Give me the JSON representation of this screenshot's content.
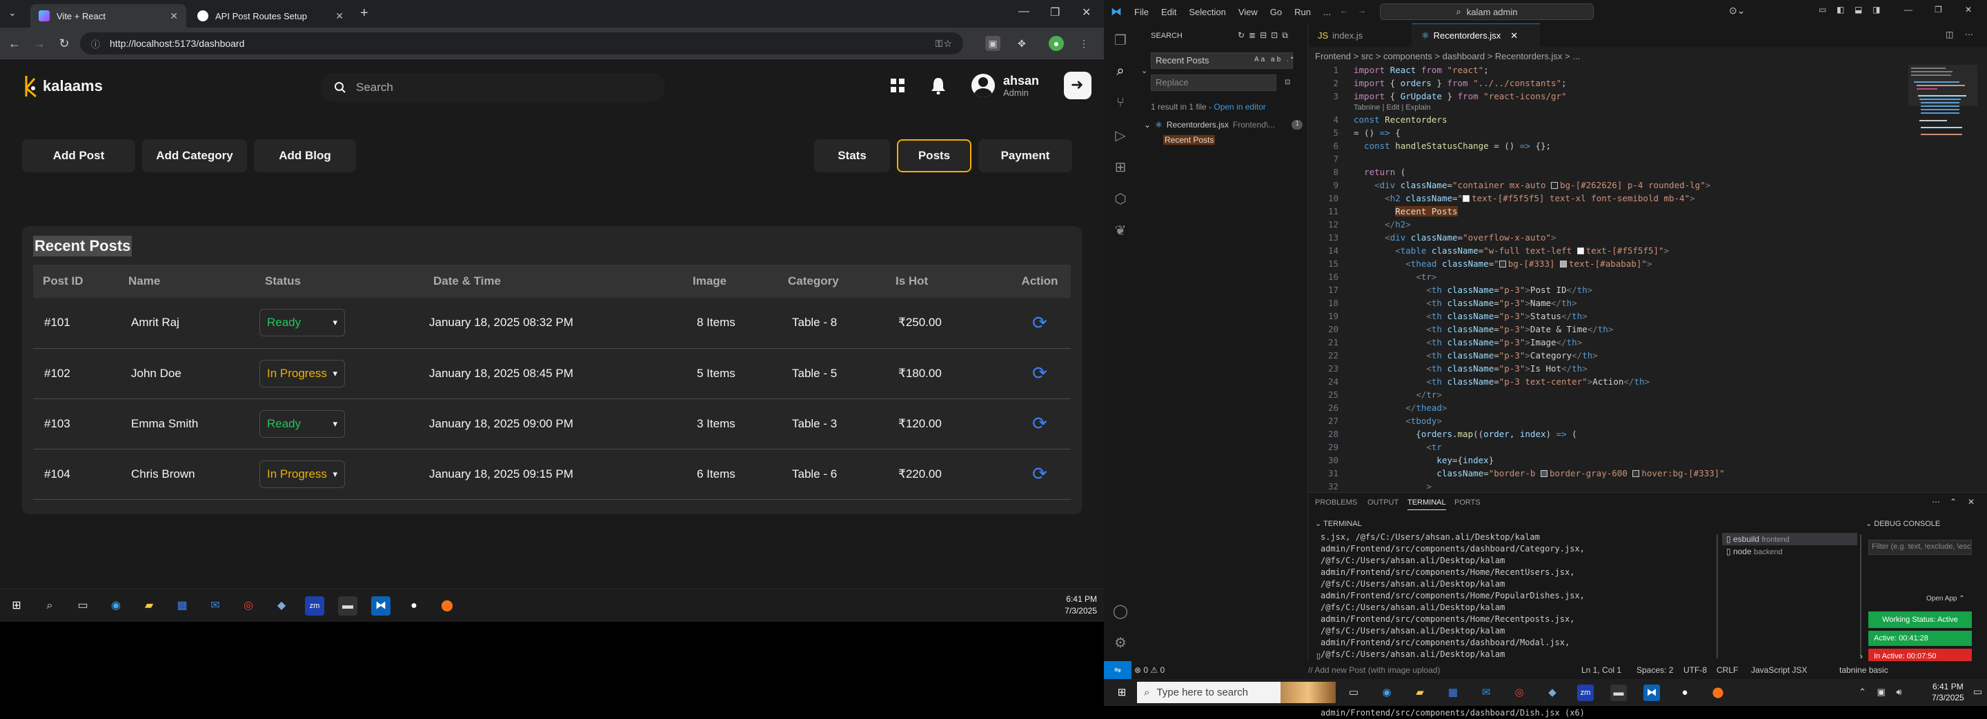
{
  "browser": {
    "tabs": [
      {
        "title": "Vite + React",
        "active": true
      },
      {
        "title": "API Post Routes Setup",
        "active": false
      }
    ],
    "url": "http://localhost:5173/dashboard"
  },
  "app": {
    "logo_text": "kalaams",
    "search_placeholder": "Search",
    "user": {
      "name": "ahsan",
      "role": "Admin"
    },
    "actions": [
      "Add Post",
      "Add Category",
      "Add Blog"
    ],
    "views": [
      {
        "label": "Stats",
        "active": false
      },
      {
        "label": "Posts",
        "active": true
      },
      {
        "label": "Payment",
        "active": false
      }
    ],
    "panel_title": "Recent Posts",
    "columns": [
      "Post ID",
      "Name",
      "Status",
      "Date & Time",
      "Image",
      "Category",
      "Is Hot",
      "Action"
    ],
    "rows": [
      {
        "id": "#101",
        "name": "Amrit Raj",
        "status": "Ready",
        "date": "January 18, 2025 08:32 PM",
        "image": "8 Items",
        "category": "Table - 8",
        "hot": "₹250.00"
      },
      {
        "id": "#102",
        "name": "John Doe",
        "status": "In Progress",
        "date": "January 18, 2025 08:45 PM",
        "image": "5 Items",
        "category": "Table - 5",
        "hot": "₹180.00"
      },
      {
        "id": "#103",
        "name": "Emma Smith",
        "status": "Ready",
        "date": "January 18, 2025 09:00 PM",
        "image": "3 Items",
        "category": "Table - 3",
        "hot": "₹120.00"
      },
      {
        "id": "#104",
        "name": "Chris Brown",
        "status": "In Progress",
        "date": "January 18, 2025 09:15 PM",
        "image": "6 Items",
        "category": "Table - 6",
        "hot": "₹220.00"
      }
    ],
    "colors": {
      "bg": "#1a1a1a",
      "panel": "#262626",
      "accent": "#f6b100",
      "ready": "#22c55e",
      "progress": "#eab308",
      "action": "#3b82f6"
    }
  },
  "left_taskbar": {
    "time": "6:41 PM",
    "date": "7/3/2025"
  },
  "vscode": {
    "menus": [
      "File",
      "Edit",
      "Selection",
      "View",
      "Go",
      "Run",
      "..."
    ],
    "command_center": "kalam admin",
    "search": {
      "header": "SEARCH",
      "query": "Recent Posts",
      "replace_placeholder": "Replace",
      "summary": "1 result in 1 file - ",
      "open_in_editor": "Open in editor",
      "file": "Recentorders.jsx",
      "file_path": "Frontend\\...",
      "count": "1",
      "match": "Recent Posts"
    },
    "tabs": [
      {
        "name": "index.js",
        "active": false
      },
      {
        "name": "Recentorders.jsx",
        "active": true
      }
    ],
    "breadcrumb": "Frontend > src > components > dashboard > Recentorders.jsx > ...",
    "codelens": "Tabnine | Edit | Explain",
    "panel_tabs": [
      "PROBLEMS",
      "OUTPUT",
      "TERMINAL",
      "PORTS"
    ],
    "terminal_label": "TERMINAL",
    "terminal_text": "s.jsx, /@fs/C:/Users/ahsan.ali/Desktop/kalam admin/Frontend/src/components/dashboard/Category.jsx, /@fs/C:/Users/ahsan.ali/Desktop/kalam admin/Frontend/src/components/Home/RecentUsers.jsx, /@fs/C:/Users/ahsan.ali/Desktop/kalam admin/Frontend/src/components/Home/PopularDishes.jsx, /@fs/C:/Users/ahsan.ali/Desktop/kalam admin/Frontend/src/components/Home/Recentposts.jsx, /@fs/C:/Users/ahsan.ali/Desktop/kalam admin/Frontend/src/components/dashboard/Modal.jsx, /@fs/C:/Users/ahsan.ali/Desktop/kalam admin/Frontend/src/components/auth/Register.jsx, /@fs/C:/Users/ahsan.ali/Desktop/kalam admin/Frontend/src/components/auth/Login.jsx, /@fs/C:/Users/ahsan.ali/Desktop/kalam admin/Frontend/src/components/dashboard/Dish.jsx (x6)",
    "terminals": [
      {
        "name": "esbuild",
        "detail": "frontend"
      },
      {
        "name": "node",
        "detail": "backend"
      }
    ],
    "debug_console": "DEBUG CONSOLE",
    "debug_filter": "Filter (e.g. text, !exclude, \\esca...",
    "open_app": "Open App",
    "working_status": "Working Status: Active",
    "active_time": "Active: 00:41:28",
    "inactive_time": "In Active: 00:07:50",
    "status": {
      "errors": "⊗ 0  ⚠ 0",
      "commit_hint": "// Add new Post (with image upload)",
      "position": "Ln 1, Col 1",
      "spaces": "Spaces: 2",
      "encoding": "UTF-8",
      "eol": "CRLF",
      "language": "JavaScript JSX",
      "tabnine": "tabnine basic"
    }
  },
  "windows_taskbar": {
    "search_placeholder": "Type here to search",
    "time": "6:41 PM",
    "date": "7/3/2025"
  }
}
